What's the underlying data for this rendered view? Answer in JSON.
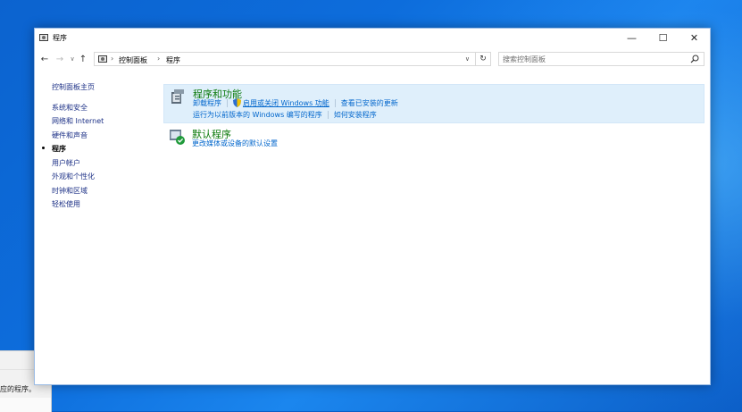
{
  "window": {
    "title": "程序",
    "minimize_glyph": "—",
    "maximize_glyph": "☐",
    "close_glyph": "✕"
  },
  "nav": {
    "back_glyph": "←",
    "forward_glyph": "→",
    "recent_glyph": "∨",
    "up_glyph": "↑",
    "refresh_glyph": "↻",
    "dropdown_glyph": "∨"
  },
  "breadcrumb": {
    "separator": "›",
    "items": [
      "控制面板",
      "程序"
    ]
  },
  "search": {
    "placeholder": "搜索控制面板",
    "value": ""
  },
  "sidebar": {
    "home": "控制面板主页",
    "items": [
      {
        "label": "系统和安全",
        "current": false
      },
      {
        "label": "网络和 Internet",
        "current": false
      },
      {
        "label": "硬件和声音",
        "current": false
      },
      {
        "label": "程序",
        "current": true
      },
      {
        "label": "用户帐户",
        "current": false
      },
      {
        "label": "外观和个性化",
        "current": false
      },
      {
        "label": "时钟和区域",
        "current": false
      },
      {
        "label": "轻松使用",
        "current": false
      }
    ]
  },
  "categories": [
    {
      "title": "程序和功能",
      "icon": "programs-features-icon",
      "highlighted": true,
      "tasks_row1": [
        "卸载程序",
        "启用或关闭 Windows 功能",
        "查看已安装的更新"
      ],
      "tasks_row2": [
        "运行为以前版本的 Windows 编写的程序",
        "如何安装程序"
      ]
    },
    {
      "title": "默认程序",
      "icon": "default-programs-icon",
      "highlighted": false,
      "tasks_row1": [
        "更改媒体或设备的默认设置"
      ]
    }
  ],
  "background_dialog": {
    "text": "应的程序。"
  },
  "colors": {
    "category_title": "#0c7a0c",
    "task_link": "#0066cc",
    "sidebar_link": "#1e3287",
    "highlight_bg": "#dfeffb",
    "desktop": "#0c63cf"
  }
}
